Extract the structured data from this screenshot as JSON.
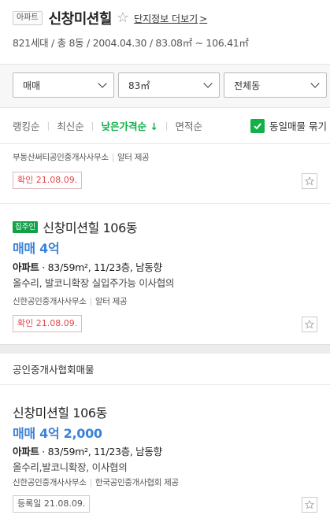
{
  "header": {
    "type_badge": "아파트",
    "title": "신창미션힐",
    "star_glyph": "☆",
    "info_link": "단지정보 더보기",
    "info_chevron": ">",
    "summary": "821세대 / 총 8동 / 2004.04.30 / 83.08㎡ ~ 106.41㎡"
  },
  "filters": {
    "trade_type": "매매",
    "area": "83㎡",
    "building": "전체동"
  },
  "sort": {
    "items": [
      "랭킹순",
      "최신순",
      "낮은가격순 ↓",
      "면적순"
    ],
    "active_index": 2,
    "same_listing_label": "동일매물 묶기",
    "same_listing_checked": true
  },
  "listings": [
    {
      "agency": "부동산써티공인중개사사무소",
      "provider": "알터 제공",
      "confirm": "확인 21.08.09."
    },
    {
      "owner_badge": "집주인",
      "name": "신창미션힐 106동",
      "price": "매매 4억",
      "spec_type": "아파트",
      "spec_rest": "· 83/59m², 11/23층, 남동향",
      "desc": "올수리, 발코니확장 실입주가능 이사협의",
      "agency": "신한공인중개사사무소",
      "provider": "알터 제공",
      "confirm": "확인 21.08.09."
    }
  ],
  "association_section": {
    "title": "공인중개사협회매물",
    "listing": {
      "name": "신창미션힐 106동",
      "price": "매매 4억 2,000",
      "spec_type": "아파트",
      "spec_rest": "· 83/59m², 11/23층, 남동향",
      "desc": "올수리,발코니확장, 이사협의",
      "agency": "신한공인중개사사무소",
      "provider": "한국공인중개사협회 제공",
      "registered": "등록일 21.08.09."
    }
  },
  "colors": {
    "accent_green": "#13b048",
    "price_blue": "#3b82d6",
    "confirm_red": "#e5474d"
  }
}
